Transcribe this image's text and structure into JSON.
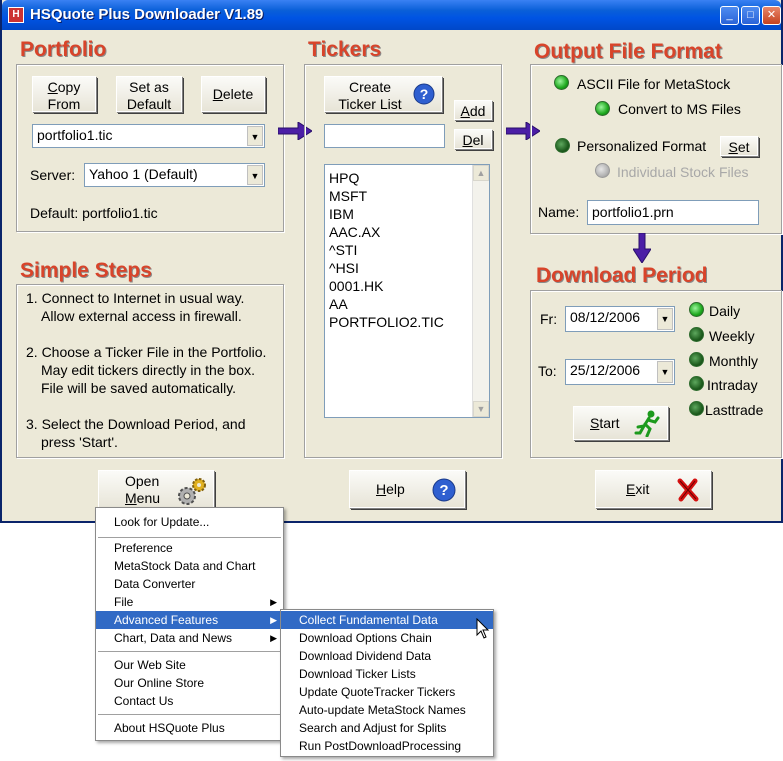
{
  "window": {
    "title": "HSQuote Plus Downloader V1.89"
  },
  "portfolio": {
    "heading": "Portfolio",
    "copy_from_line1": "Copy",
    "copy_from_line2": "From",
    "set_default_line1": "Set as",
    "set_default_line2": "Default",
    "delete_label": "Delete",
    "selected_file": "portfolio1.tic",
    "server_label": "Server:",
    "server_value": "Yahoo 1 (Default)",
    "default_text": "Default: portfolio1.tic"
  },
  "tickers": {
    "heading": "Tickers",
    "create_line1": "Create",
    "create_line2": "Ticker List",
    "add_label": "Add",
    "del_label": "Del",
    "input_value": "",
    "items": [
      "HPQ",
      "MSFT",
      "IBM",
      "AAC.AX",
      "^STI",
      "^HSI",
      "0001.HK",
      "AA",
      "PORTFOLIO2.TIC"
    ]
  },
  "output": {
    "heading": "Output File Format",
    "ascii_label": "ASCII File for MetaStock",
    "convert_label": "Convert to MS Files",
    "personalized_label": "Personalized Format",
    "set_label": "Set",
    "individual_label": "Individual Stock Files",
    "name_label": "Name:",
    "name_value": "portfolio1.prn"
  },
  "steps": {
    "heading": "Simple Steps",
    "s1a": "1. Connect to Internet in usual way.",
    "s1b": "Allow external access in firewall.",
    "s2a": "2. Choose a Ticker File in the Portfolio.",
    "s2b": "May edit tickers directly in the box.",
    "s2c": "File will be saved automatically.",
    "s3a": "3. Select the Download Period, and",
    "s3b": "press 'Start'."
  },
  "period": {
    "heading": "Download Period",
    "from_label": "Fr:",
    "from_value": "08/12/2006",
    "to_label": "To:",
    "to_value": "25/12/2006",
    "daily": "Daily",
    "weekly": "Weekly",
    "monthly": "Monthly",
    "intraday": "Intraday",
    "lasttrade": "Lasttrade",
    "start_label": "Start"
  },
  "bottom": {
    "open_line1": "Open",
    "open_line2": "Menu",
    "help_label": "Help",
    "exit_label": "Exit"
  },
  "menu": {
    "look_update": "Look for Update...",
    "preference": "Preference",
    "metastock": "MetaStock Data and Chart",
    "converter": "Data Converter",
    "file": "File",
    "advanced": "Advanced Features",
    "chart_news": "Chart, Data and News",
    "website": "Our Web Site",
    "store": "Our Online Store",
    "contact": "Contact Us",
    "about": "About HSQuote Plus"
  },
  "submenu": {
    "items": [
      "Collect Fundamental Data",
      "Download Options Chain",
      "Download Dividend Data",
      "Download Ticker Lists",
      "Update QuoteTracker Tickers",
      "Auto-update MetaStock Names",
      "Search and Adjust for Splits",
      "Run PostDownloadProcessing"
    ]
  }
}
